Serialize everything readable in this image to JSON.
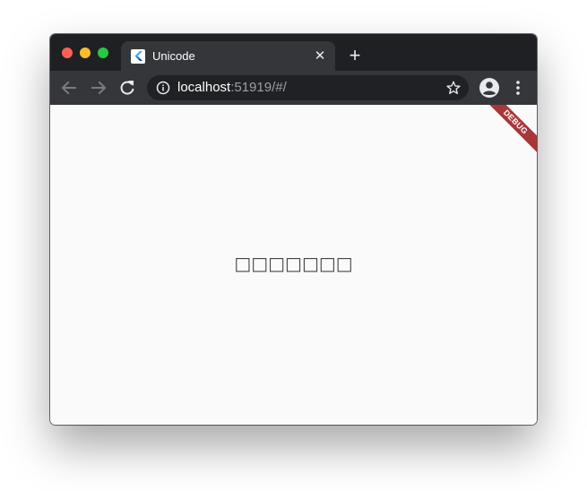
{
  "browser": {
    "tab": {
      "title": "Unicode",
      "favicon": "flutter-logo-icon",
      "close_icon": "close-icon"
    },
    "new_tab_icon": "plus-icon",
    "toolbar": {
      "back_icon": "back-arrow-icon",
      "forward_icon": "forward-arrow-icon",
      "reload_icon": "reload-icon",
      "profile_icon": "profile-icon",
      "menu_icon": "kebab-menu-icon"
    },
    "omnibox": {
      "info_icon": "info-icon",
      "url_host": "localhost",
      "url_rest": ":51919/#/",
      "bookmark_icon": "star-icon"
    }
  },
  "page": {
    "center_text": "□□□□□□□",
    "debug_banner": "DEBUG"
  },
  "colors": {
    "titlebar": "#1f2023",
    "toolbar": "#35363a",
    "omnibox": "#202124",
    "page_bg": "#fafafa",
    "debug_banner": "#a8373a",
    "flutter_blue": "#42a5f5"
  }
}
